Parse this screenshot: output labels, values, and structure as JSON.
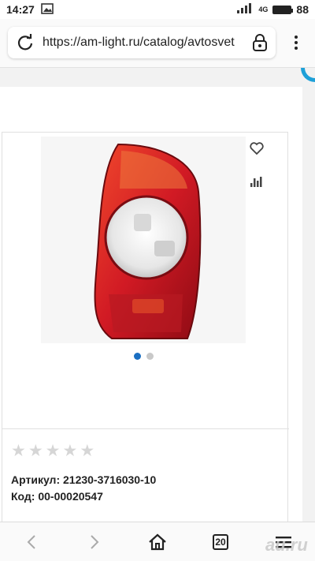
{
  "status_bar": {
    "time": "14:27",
    "network": "4G",
    "battery": "88"
  },
  "browser": {
    "url": "https://am-light.ru/catalog/avtosvet",
    "tab_count": "20"
  },
  "product": {
    "article_label": "Артикул:",
    "article_value": "21230-3716030-10",
    "code_label": "Код:",
    "code_value": "00-00020547",
    "rating": 0,
    "rating_max": 5,
    "image_count": 2,
    "active_image": 1
  },
  "icons": {
    "favorite": "heart-icon",
    "compare": "bar-chart-icon",
    "reload": "reload-icon",
    "lock": "lock-icon"
  },
  "watermark": "au.ru"
}
